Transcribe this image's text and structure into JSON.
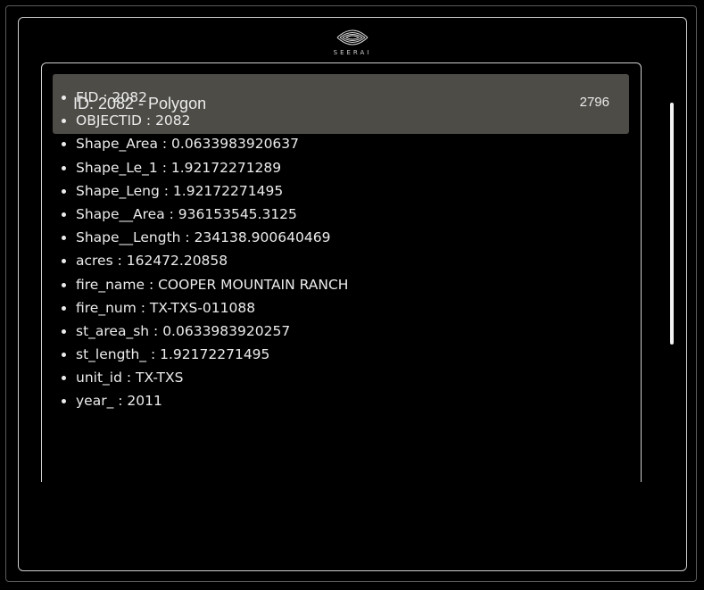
{
  "brand": {
    "logo_icon": "eye-logo-icon",
    "name": "SEERAI"
  },
  "feature": {
    "title": "ID: 2082 - Polygon",
    "count": "2796"
  },
  "properties": [
    "FID : 2082",
    "OBJECTID : 2082",
    "Shape_Area : 0.0633983920637",
    "Shape_Le_1 : 1.92172271289",
    "Shape_Leng : 1.92172271495",
    "Shape__Area : 936153545.3125",
    "Shape__Length : 234138.900640469",
    "acres : 162472.20858",
    "fire_name : COOPER MOUNTAIN RANCH",
    "fire_num : TX-TXS-011088",
    "st_area_sh : 0.0633983920257",
    "st_length_ : 1.92172271495",
    "unit_id : TX-TXS",
    "year_ : 2011"
  ],
  "colors": {
    "background": "#000000",
    "header": "#4d4c47",
    "text": "#ececec"
  }
}
